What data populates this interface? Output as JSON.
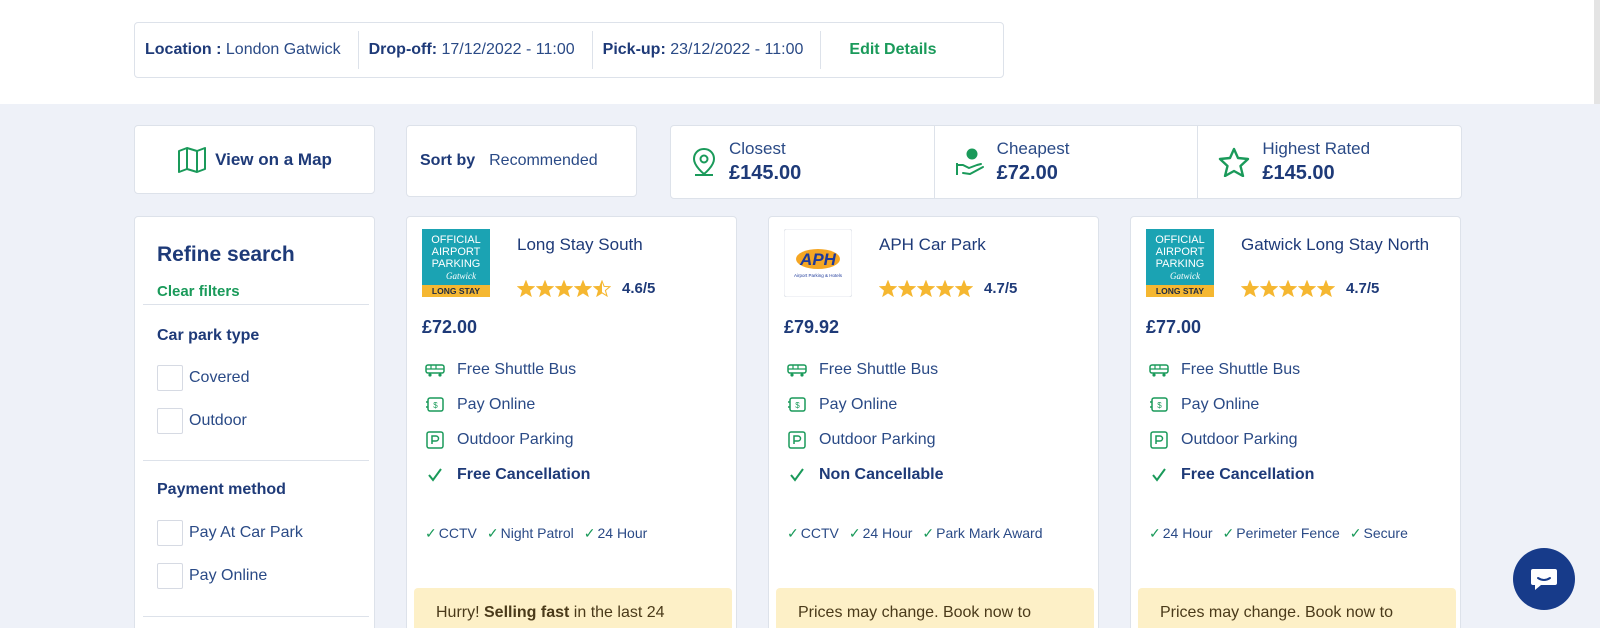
{
  "details": {
    "location_label": "Location :",
    "location_value": "London Gatwick",
    "dropoff_label": "Drop-off:",
    "dropoff_value": "17/12/2022 - 11:00",
    "pickup_label": "Pick-up:",
    "pickup_value": "23/12/2022 - 11:00",
    "edit_label": "Edit Details"
  },
  "map_button": {
    "label": "View on a Map",
    "icon": "map-icon"
  },
  "sort": {
    "label": "Sort by",
    "value": "Recommended"
  },
  "summary": [
    {
      "title": "Closest",
      "price": "£145.00",
      "icon": "location-pin-icon"
    },
    {
      "title": "Cheapest",
      "price": "£72.00",
      "icon": "money-hand-icon"
    },
    {
      "title": "Highest Rated",
      "price": "£145.00",
      "icon": "star-icon"
    }
  ],
  "refine": {
    "title": "Refine search",
    "clear": "Clear filters",
    "car_park_type": {
      "title": "Car park type",
      "options": [
        "Covered",
        "Outdoor"
      ]
    },
    "payment_method": {
      "title": "Payment method",
      "options": [
        "Pay At Car Park",
        "Pay Online"
      ]
    }
  },
  "cards": [
    {
      "name": "Long Stay South",
      "logo_lines": [
        "OFFICIAL",
        "AIRPORT",
        "PARKING",
        "Gatwick",
        "LONG STAY"
      ],
      "stars_filled": 4.5,
      "rating": "4.6/5",
      "price": "£72.00",
      "features": [
        "Free Shuttle Bus",
        "Pay Online",
        "Outdoor Parking"
      ],
      "cancellation": "Free Cancellation",
      "tags": [
        "CCTV",
        "Night Patrol",
        "24 Hour"
      ],
      "banner_pre": "Hurry! ",
      "banner_bold": "Selling fast",
      "banner_post": " in the last 24"
    },
    {
      "name": "APH Car Park",
      "logo_lines": [
        "APH",
        "Airport Parking & Hotels"
      ],
      "stars_filled": 5,
      "rating": "4.7/5",
      "price": "£79.92",
      "features": [
        "Free Shuttle Bus",
        "Pay Online",
        "Outdoor Parking"
      ],
      "cancellation": "Non Cancellable",
      "tags": [
        "CCTV",
        "24 Hour",
        "Park Mark Award"
      ],
      "banner_pre": "Prices may change. Book now to",
      "banner_bold": "",
      "banner_post": ""
    },
    {
      "name": "Gatwick Long Stay North",
      "logo_lines": [
        "OFFICIAL",
        "AIRPORT",
        "PARKING",
        "Gatwick",
        "LONG STAY"
      ],
      "stars_filled": 5,
      "rating": "4.7/5",
      "price": "£77.00",
      "features": [
        "Free Shuttle Bus",
        "Pay Online",
        "Outdoor Parking"
      ],
      "cancellation": "Free Cancellation",
      "tags": [
        "24 Hour",
        "Perimeter Fence",
        "Secure"
      ],
      "banner_pre": "Prices may change. Book now to",
      "banner_bold": "",
      "banner_post": ""
    }
  ],
  "colors": {
    "brand": "#1e3a78",
    "accent": "#1a9a5a",
    "star": "#f5b731",
    "banner": "#fdf0c7",
    "chat": "#173b8a"
  }
}
